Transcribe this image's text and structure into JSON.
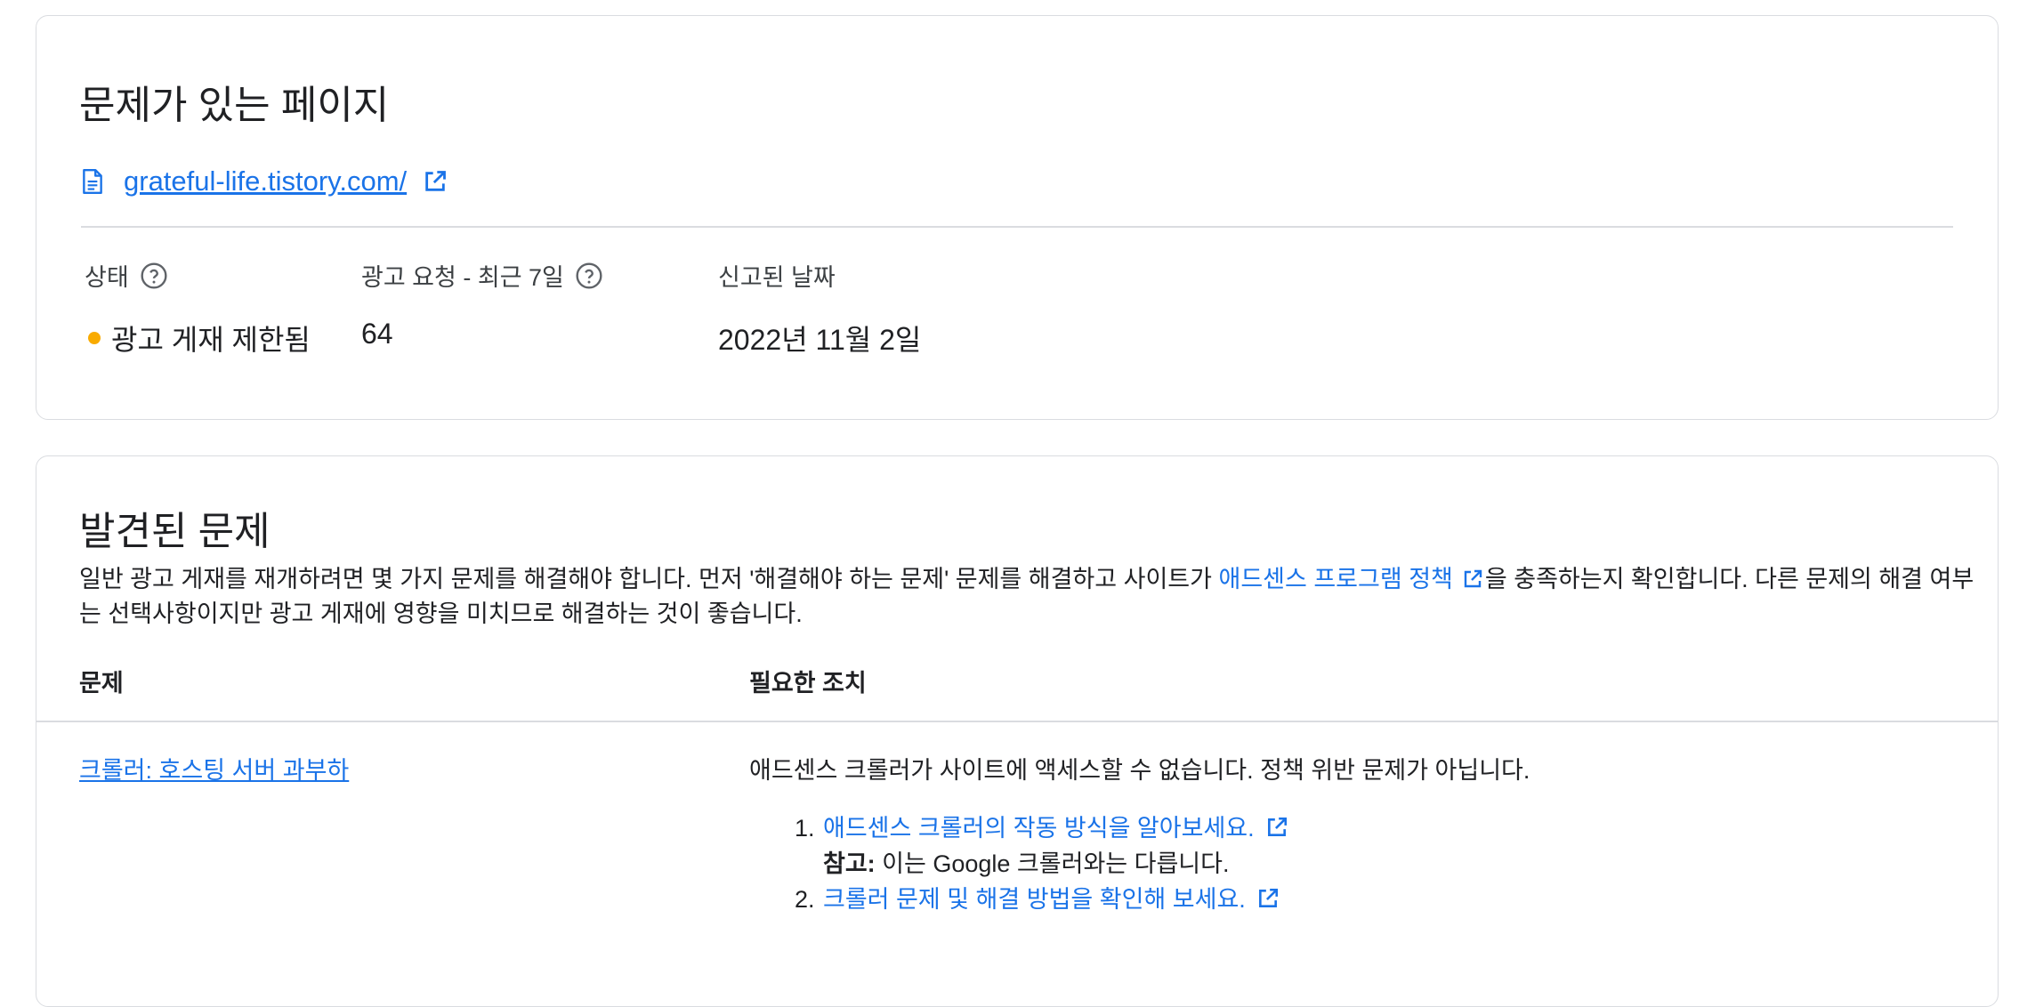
{
  "page_card": {
    "title": "문제가 있는 페이지",
    "url": "grateful-life.tistory.com/",
    "columns": {
      "status_label": "상태",
      "status_value": "광고 게재 제한됨",
      "requests_label": "광고 요청 - 최근 7일",
      "requests_value": "64",
      "date_label": "신고된 날짜",
      "date_value": "2022년 11월 2일"
    },
    "status_color": "#f9ab00"
  },
  "issues_card": {
    "title": "발견된 문제",
    "desc_part1": "일반 광고 게재를 재개하려면 몇 가지 문제를 해결해야 합니다. 먼저 '해결해야 하는 문제' 문제를 해결하고 사이트가 ",
    "desc_link": "애드센스 프로그램 정책",
    "desc_part2": "을 충족하는지 확인합니다. 다른 문제의 해결 여부는 선택사항이지만 광고 게재에 영향을 미치므로 해결하는 것이 좋습니다.",
    "table_headers": {
      "problem": "문제",
      "action": "필요한 조치"
    },
    "rows": [
      {
        "problem": "크롤러: 호스팅 서버 과부하",
        "action": "애드센스 크롤러가 사이트에 액세스할 수 없습니다. 정책 위반 문제가 아닙니다.",
        "steps": [
          {
            "link": "애드센스 크롤러의 작동 방식을 알아보세요.",
            "note_label": "참고:",
            "note_text": " 이는 Google 크롤러와는 다릅니다."
          },
          {
            "link": "크롤러 문제 및 해결 방법을 확인해 보세요."
          }
        ]
      }
    ]
  },
  "colors": {
    "link": "#1a73e8",
    "border": "#dadce0",
    "text": "#202124"
  }
}
